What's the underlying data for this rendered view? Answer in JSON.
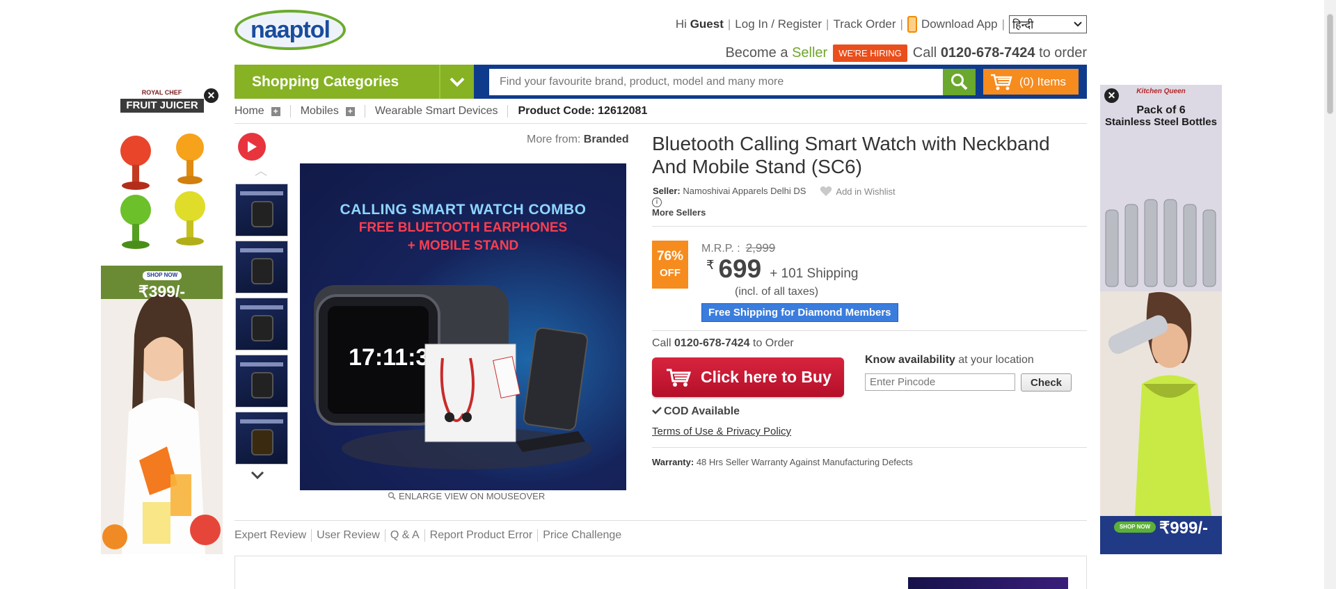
{
  "header": {
    "logo_text": "naaptol",
    "greeting_prefix": "Hi",
    "greeting_user": "Guest",
    "login": "Log In / Register",
    "track_order": "Track Order",
    "download_app": "Download App",
    "language": "हिन्दी",
    "become_prefix": "Become a",
    "become_seller": "Seller",
    "hiring_badge": "WE'RE HIRING",
    "call_prefix": "Call",
    "call_number": "0120-678-7424",
    "call_suffix": "to order"
  },
  "nav": {
    "categories_label": "Shopping Categories",
    "search_placeholder": "Find your favourite brand, product, model and many more",
    "cart_label": "(0) Items"
  },
  "breadcrumb": {
    "items": [
      "Home",
      "Mobiles",
      "Wearable Smart Devices"
    ],
    "product_code_label": "Product Code:",
    "product_code": "12612081"
  },
  "ads": {
    "left": {
      "brand": "ROYAL CHEF",
      "title": "FRUIT JUICER",
      "cta": "SHOP NOW",
      "price": "₹399/-"
    },
    "right": {
      "brand": "Kitchen Queen",
      "title_line1": "Pack of 6",
      "title_line2": "Stainless Steel Bottles",
      "cta": "SHOP NOW",
      "price": "₹999/-"
    }
  },
  "gallery": {
    "more_from_label": "More from:",
    "more_from_brand": "Branded",
    "image_line1": "CALLING SMART WATCH COMBO",
    "image_line2": "FREE BLUETOOTH EARPHONES",
    "image_line3": "+ MOBILE STAND",
    "watch_time": "17:11:32",
    "free_tag": "FREE",
    "enlarge_label": "ENLARGE VIEW ON MOUSEOVER"
  },
  "product": {
    "title": "Bluetooth Calling Smart Watch with Neckband And Mobile Stand (SC6)",
    "seller_label": "Seller:",
    "seller_name": "Namoshivai Apparels Delhi DS",
    "wishlist": "Add in Wishlist",
    "more_sellers": "More Sellers",
    "discount_pct": "76%",
    "discount_off": "OFF",
    "mrp_label": "M.R.P. :",
    "mrp_value": "2,999",
    "currency": "₹",
    "price": "699",
    "shipping": "+ 101 Shipping",
    "taxes": "(incl. of all taxes)",
    "diamond_badge": "Free Shipping for Diamond Members",
    "call_prefix": "Call",
    "call_number": "0120-678-7424",
    "call_suffix": "to Order",
    "buy_label": "Click here to Buy",
    "availability_bold": "Know availability",
    "availability_rest": "at your location",
    "pincode_placeholder": "Enter Pincode",
    "check_label": "Check",
    "cod": "COD Available",
    "terms": "Terms of Use & Privacy Policy",
    "warranty_label": "Warranty:",
    "warranty_text": "48 Hrs Seller Warranty Against Manufacturing Defects"
  },
  "tabs": [
    "Expert Review",
    "User Review",
    "Q & A",
    "Report Product Error",
    "Price Challenge"
  ],
  "colors": {
    "brand_blue": "#0f3b8c",
    "category_green": "#86b223",
    "cart_orange": "#f68b1e",
    "buy_red": "#c8172f",
    "diamond_blue": "#3b7ddd"
  }
}
